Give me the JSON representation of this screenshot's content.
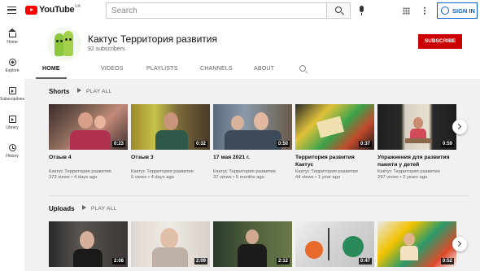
{
  "topbar": {
    "logo_text": "YouTube",
    "logo_region": "UA",
    "search_placeholder": "Search",
    "signin_label": "SIGN IN"
  },
  "sidebar": {
    "items": [
      {
        "label": "Home",
        "icon": "home-icon"
      },
      {
        "label": "Explore",
        "icon": "explore-icon"
      },
      {
        "label": "Subscriptions",
        "icon": "subscriptions-icon"
      },
      {
        "label": "Library",
        "icon": "library-icon"
      },
      {
        "label": "History",
        "icon": "history-icon"
      }
    ]
  },
  "channel": {
    "name": "Кактус Территория развития",
    "subscribers": "92 subscribers",
    "subscribe_label": "SUBSCRIBE"
  },
  "tabs": [
    {
      "label": "HOME",
      "active": true
    },
    {
      "label": "VIDEOS",
      "active": false
    },
    {
      "label": "PLAYLISTS",
      "active": false
    },
    {
      "label": "CHANNELS",
      "active": false
    },
    {
      "label": "ABOUT",
      "active": false
    }
  ],
  "shorts": {
    "title": "Shorts",
    "play_all": "PLAY ALL",
    "videos": [
      {
        "title": "Отзыв 4",
        "channel": "Кактус Территория развития",
        "meta": "372 views • 4 days ago",
        "duration": "0:23"
      },
      {
        "title": "Отзыв 3",
        "channel": "Кактус Территория развития",
        "meta": "5 views • 4 days ago",
        "duration": "0:32"
      },
      {
        "title": "17 мая 2021 г.",
        "channel": "Кактус Территория развития",
        "meta": "37 views • 5 months ago",
        "duration": "0:50"
      },
      {
        "title": "Территория развития Кактус",
        "channel": "Кактус Территория развития",
        "meta": "44 views • 1 year ago",
        "duration": "0:37"
      },
      {
        "title": "Упражнения для развития памяти у детей",
        "channel": "Кактус Территория развития",
        "meta": "297 views • 2 years ago",
        "duration": "0:59"
      }
    ]
  },
  "uploads": {
    "title": "Uploads",
    "play_all": "PLAY ALL",
    "videos": [
      {
        "duration": "2:08"
      },
      {
        "duration": "2:09"
      },
      {
        "duration": "2:12"
      },
      {
        "duration": "0:47"
      },
      {
        "duration": "0:52"
      }
    ]
  }
}
